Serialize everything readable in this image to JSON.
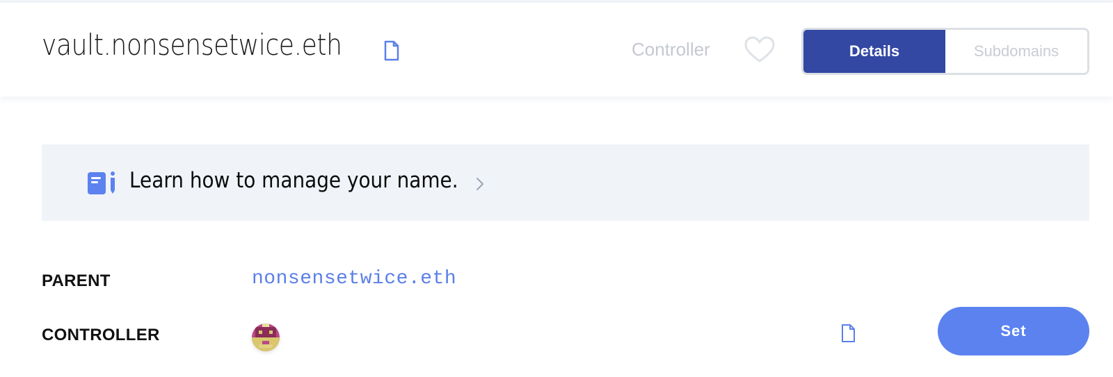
{
  "header": {
    "domain": "vault.nonsensetwice.eth",
    "controller_tag": "Controller",
    "tabs": [
      {
        "label": "Details",
        "active": true
      },
      {
        "label": "Subdomains",
        "active": false
      }
    ]
  },
  "banner": {
    "text": "Learn how to manage your name."
  },
  "details": {
    "parent": {
      "label": "PARENT",
      "value": "nonsensetwice.eth"
    },
    "controller": {
      "label": "CONTROLLER",
      "button_label": "Set"
    }
  },
  "colors": {
    "accent": "#5b82ef",
    "tab_active": "#3348a3",
    "banner_bg": "#f0f4f8",
    "link": "#5b7fe8"
  }
}
